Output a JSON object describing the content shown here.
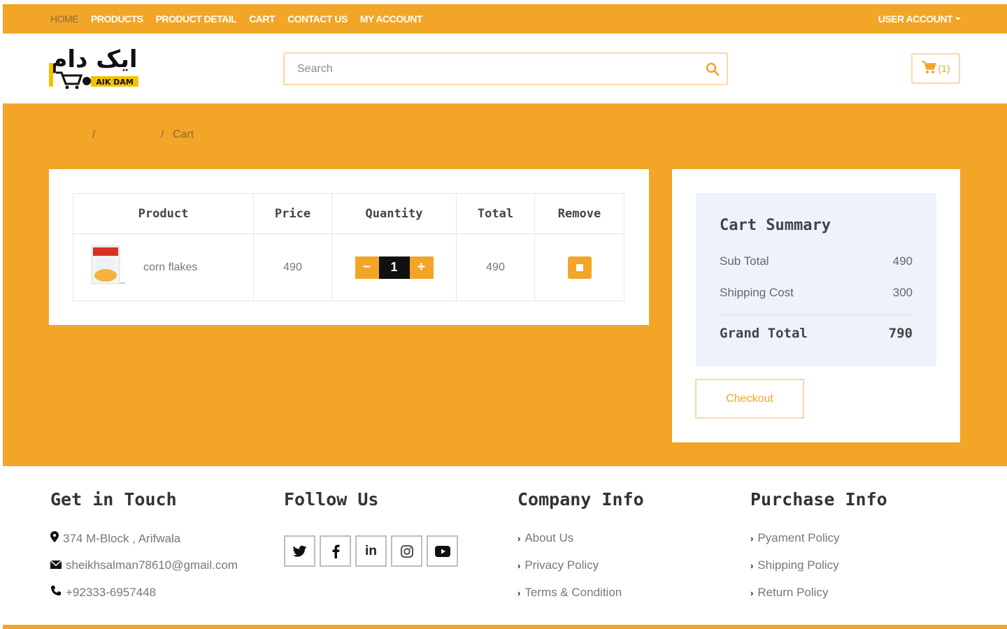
{
  "nav": {
    "items": [
      "HOME",
      "PRODUCTS",
      "PRODUCT DETAIL",
      "CART",
      "CONTACT US",
      "MY ACCOUNT"
    ],
    "user_account": "USER ACCOUNT"
  },
  "logo": {
    "urdu": "ایک دام",
    "latin": "AIK DAM"
  },
  "search": {
    "placeholder": "Search"
  },
  "cart_button": {
    "count": "(1)"
  },
  "breadcrumb": {
    "sep1": "/",
    "sep2": "/",
    "current": "Cart"
  },
  "cart_table": {
    "headers": [
      "Product",
      "Price",
      "Quantity",
      "Total",
      "Remove"
    ],
    "rows": [
      {
        "product": "corn flakes",
        "price": "490",
        "quantity": "1",
        "total": "490"
      }
    ],
    "minus": "−",
    "plus": "+"
  },
  "summary": {
    "title": "Cart Summary",
    "subtotal_label": "Sub Total",
    "subtotal": "490",
    "shipping_label": "Shipping Cost",
    "shipping": "300",
    "grand_label": "Grand Total",
    "grand": "790",
    "checkout": "Checkout"
  },
  "footer": {
    "contact": {
      "title": "Get in Touch",
      "address": "374 M-Block , Arifwala",
      "email": "sheikhsalman78610@gmail.com",
      "phone": "+92333-6957448"
    },
    "follow": {
      "title": "Follow Us",
      "linkedin": "in"
    },
    "company": {
      "title": "Company Info",
      "links": [
        "About Us",
        "Privacy Policy",
        "Terms & Condition"
      ]
    },
    "purchase": {
      "title": "Purchase Info",
      "links": [
        "Pyament Policy",
        "Shipping Policy",
        "Return Policy"
      ]
    }
  },
  "colors": {
    "accent": "#f2a527",
    "summary_bg": "#eef2fb"
  }
}
